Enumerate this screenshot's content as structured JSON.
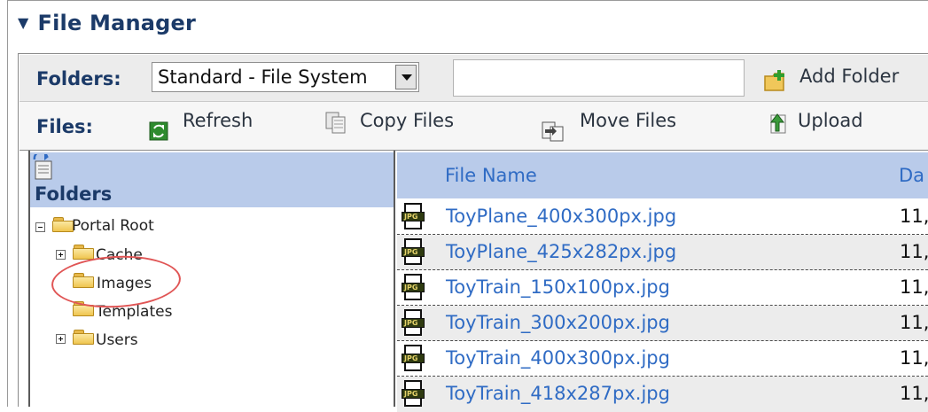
{
  "panel": {
    "title": "File Manager"
  },
  "folders_bar": {
    "label": "Folders:",
    "selected_source": "Standard - File System",
    "new_folder_value": "",
    "add_folder_label": "Add Folder"
  },
  "files_bar": {
    "label": "Files:",
    "refresh_label": "Refresh",
    "copy_label": "Copy Files",
    "move_label": "Move Files",
    "upload_label": "Upload"
  },
  "tree": {
    "header": "Folders",
    "root": "Portal Root",
    "children": [
      "Cache",
      "Images",
      "Templates",
      "Users"
    ],
    "selected": "Images"
  },
  "file_grid": {
    "columns": [
      "File Name",
      "Da"
    ],
    "rows": [
      {
        "name": "ToyPlane_400x300px.jpg",
        "date": "11,"
      },
      {
        "name": "ToyPlane_425x282px.jpg",
        "date": "11,"
      },
      {
        "name": "ToyTrain_150x100px.jpg",
        "date": "11,"
      },
      {
        "name": "ToyTrain_300x200px.jpg",
        "date": "11,"
      },
      {
        "name": "ToyTrain_400x300px.jpg",
        "date": "11,"
      },
      {
        "name": "ToyTrain_418x287px.jpg",
        "date": "11,"
      }
    ]
  },
  "icons": {
    "title": "triangle-down-icon",
    "add_folder": "add-folder-icon",
    "refresh": "refresh-icon",
    "copy": "copy-files-icon",
    "move": "move-files-icon",
    "upload": "upload-icon",
    "tree_header": "folders-tree-icon",
    "file": "jpg-file-icon"
  },
  "colors": {
    "accent": "#1b3a68",
    "header_bg": "#b9cbea",
    "link": "#2f6bc4",
    "highlight": "#e05555"
  }
}
